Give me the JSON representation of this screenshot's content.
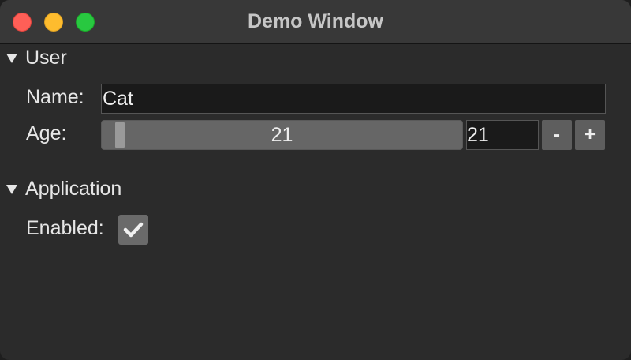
{
  "window": {
    "title": "Demo Window",
    "controls": {
      "close_color": "#fe5f57",
      "minimize_color": "#febc2e",
      "maximize_color": "#28c840"
    }
  },
  "sections": {
    "user": {
      "header": "User",
      "expanded": true,
      "name_label": "Name:",
      "name_value": "Cat",
      "age_label": "Age:",
      "age_slider_value": "21",
      "age_input_value": "21",
      "decrement_label": "-",
      "increment_label": "+"
    },
    "application": {
      "header": "Application",
      "expanded": true,
      "enabled_label": "Enabled:",
      "enabled_checked": true
    }
  },
  "icons": {
    "collapse": "triangle-down-icon",
    "check": "checkmark-icon"
  }
}
